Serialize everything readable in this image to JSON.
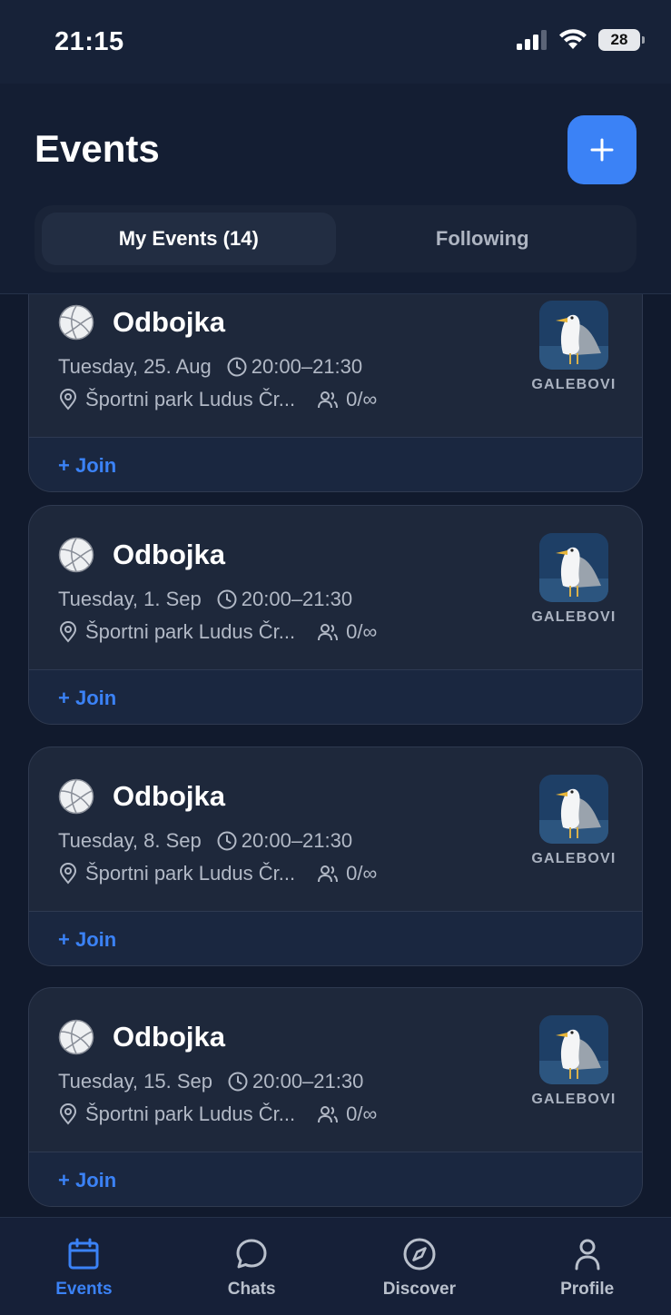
{
  "status_bar": {
    "time": "21:15",
    "battery": "28"
  },
  "header": {
    "title": "Events",
    "add_icon": "plus-icon",
    "tabs": [
      {
        "label": "My Events (14)",
        "active": true
      },
      {
        "label": "Following",
        "active": false
      }
    ]
  },
  "events": [
    {
      "title": "Odbojka",
      "date": "Tuesday, 25. Aug",
      "time": "20:00–21:30",
      "location": "Športni park Ludus Čr...",
      "attendees": "0/∞",
      "organizer": "GALEBOVI",
      "join_label": "+ Join"
    },
    {
      "title": "Odbojka",
      "date": "Tuesday, 1. Sep",
      "time": "20:00–21:30",
      "location": "Športni park Ludus Čr...",
      "attendees": "0/∞",
      "organizer": "GALEBOVI",
      "join_label": "+ Join"
    },
    {
      "title": "Odbojka",
      "date": "Tuesday, 8. Sep",
      "time": "20:00–21:30",
      "location": "Športni park Ludus Čr...",
      "attendees": "0/∞",
      "organizer": "GALEBOVI",
      "join_label": "+ Join"
    },
    {
      "title": "Odbojka",
      "date": "Tuesday, 15. Sep",
      "time": "20:00–21:30",
      "location": "Športni park Ludus Čr...",
      "attendees": "0/∞",
      "organizer": "GALEBOVI",
      "join_label": "+ Join"
    }
  ],
  "tab_bar": {
    "items": [
      {
        "label": "Events",
        "icon": "calendar-icon",
        "active": true
      },
      {
        "label": "Chats",
        "icon": "chat-bubble-icon",
        "active": false
      },
      {
        "label": "Discover",
        "icon": "compass-icon",
        "active": false
      },
      {
        "label": "Profile",
        "icon": "person-icon",
        "active": false
      }
    ]
  },
  "colors": {
    "accent": "#3b82f6",
    "background": "#111a2d",
    "card": "#1e283b"
  }
}
